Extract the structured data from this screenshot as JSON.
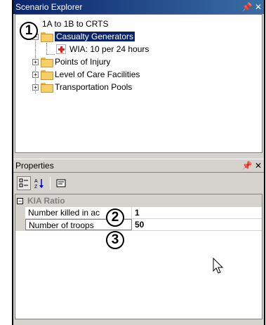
{
  "explorer": {
    "title": "Scenario Explorer",
    "pin_glyph": "   ",
    "root": "1A to 1B to CRTS",
    "items": [
      {
        "label": "Casualty Generators",
        "expander": "−",
        "selected": true
      },
      {
        "label": "WIA: 10 per 24 hours",
        "icon": "red-cross-icon"
      },
      {
        "label": "Points of Injury",
        "expander": "+"
      },
      {
        "label": "Level of Care Facilities",
        "expander": "+"
      },
      {
        "label": "Transportation Pools",
        "expander": "+"
      }
    ]
  },
  "properties": {
    "title": "Properties",
    "category": {
      "label": "KIA Ratio",
      "expander": "−"
    },
    "rows": [
      {
        "name": "Number killed in ac",
        "value": "1"
      },
      {
        "name": "Number of troops",
        "value": "50"
      }
    ]
  },
  "callouts": [
    "1",
    "2",
    "3"
  ],
  "colors": {
    "title_active": "#0a246a",
    "selection": "#0a246a",
    "folder": "#f5cf68",
    "cross": "#e02020",
    "pane_bg": "#d6d3ce"
  }
}
